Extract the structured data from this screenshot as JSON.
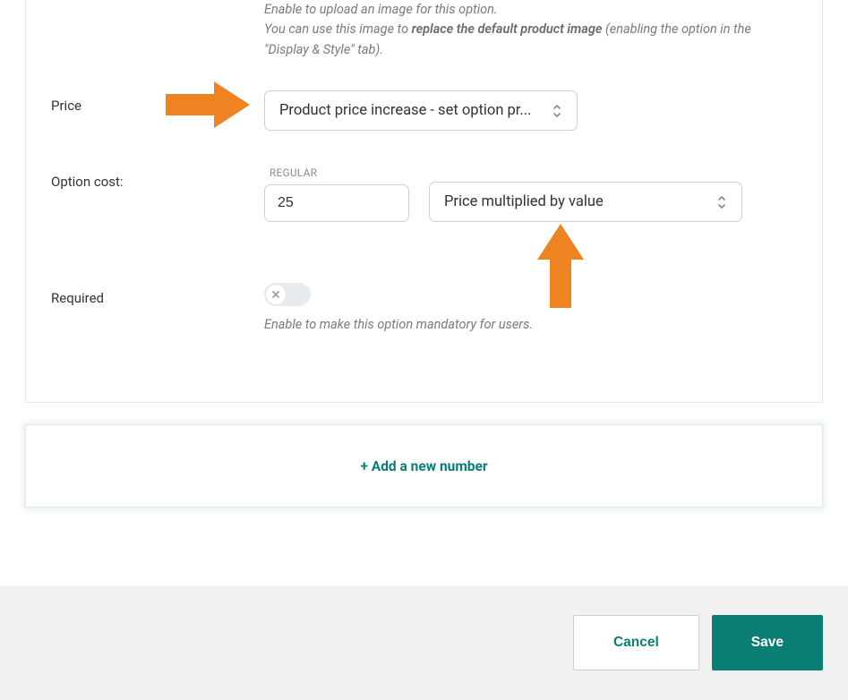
{
  "imageHelp": {
    "line1": "Enable to upload an image for this option.",
    "line2_prefix": "You can use this image to ",
    "line2_bold": "replace the default product image",
    "line2_suffix": " (enabling the option in the \"Display & Style\" tab)."
  },
  "price": {
    "label": "Price",
    "selected": "Product price increase - set option pr..."
  },
  "optionCost": {
    "label": "Option cost:",
    "regularLabel": "REGULAR",
    "regularValue": "25",
    "multiplierSelected": "Price multiplied by value"
  },
  "required": {
    "label": "Required",
    "help": "Enable to make this option mandatory for users."
  },
  "addNumber": {
    "label": "+  Add a new number"
  },
  "footer": {
    "cancel": "Cancel",
    "save": "Save"
  },
  "colors": {
    "arrow": "#ee8421"
  }
}
